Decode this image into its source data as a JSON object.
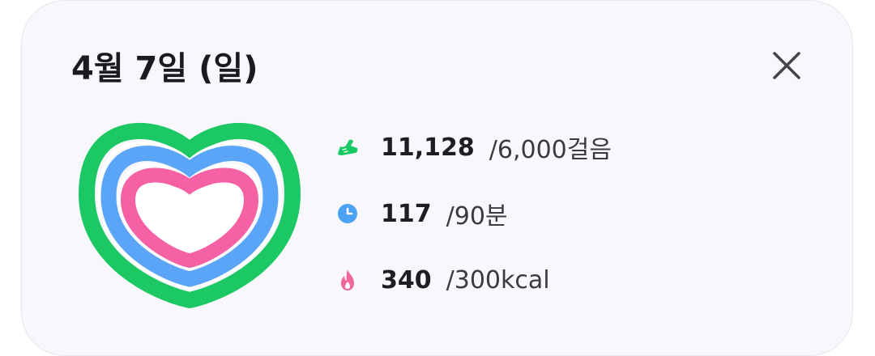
{
  "header": {
    "date_title": "4월 7일 (일)"
  },
  "stats": {
    "steps": {
      "icon": "sneaker-icon",
      "value": "11,128",
      "goal": "/6,000걸음",
      "color": "#18c964"
    },
    "active_minutes": {
      "icon": "clock-icon",
      "value": "117",
      "goal": "/90분",
      "color": "#4aa3f5"
    },
    "calories": {
      "icon": "flame-icon",
      "value": "340",
      "goal": "/300kcal",
      "color": "#f2669c"
    }
  },
  "rings": {
    "steps_progress": 1.0,
    "active_minutes_progress": 1.0,
    "calories_progress": 1.0
  },
  "colors": {
    "green_ring": "#1cc863",
    "blue_ring": "#5aa5f8",
    "pink_ring": "#f660a5"
  }
}
